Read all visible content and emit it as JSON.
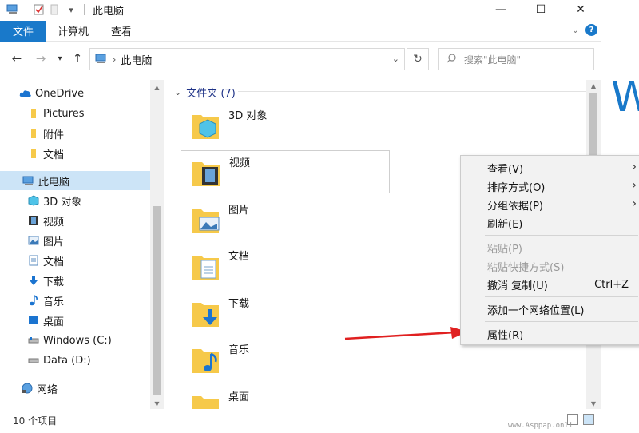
{
  "window": {
    "title": "此电脑",
    "controls": [
      "minimize-icon",
      "maximize-icon",
      "close-icon"
    ]
  },
  "ribbon": {
    "tabs": [
      {
        "label": "文件"
      },
      {
        "label": "计算机"
      },
      {
        "label": "查看"
      }
    ],
    "help": "?"
  },
  "address": {
    "path": "此电脑",
    "search_placeholder": "搜索\"此电脑\""
  },
  "nav": {
    "items": [
      {
        "label": "OneDrive",
        "icon": "cloud-icon"
      },
      {
        "label": "Pictures",
        "icon": "folder-icon"
      },
      {
        "label": "附件",
        "icon": "folder-icon"
      },
      {
        "label": "文档",
        "icon": "folder-icon"
      },
      {
        "label": "此电脑",
        "icon": "pc-icon"
      },
      {
        "label": "3D 对象",
        "icon": "3d-objects-icon"
      },
      {
        "label": "视频",
        "icon": "video-icon"
      },
      {
        "label": "图片",
        "icon": "picture-icon"
      },
      {
        "label": "文档",
        "icon": "document-icon"
      },
      {
        "label": "下载",
        "icon": "download-icon"
      },
      {
        "label": "音乐",
        "icon": "music-icon"
      },
      {
        "label": "桌面",
        "icon": "desktop-icon"
      },
      {
        "label": "Windows (C:)",
        "icon": "drive-icon"
      },
      {
        "label": "Data (D:)",
        "icon": "drive-icon"
      },
      {
        "label": "网络",
        "icon": "network-icon"
      }
    ]
  },
  "content": {
    "group_header": "文件夹 (7)",
    "folders": [
      {
        "label": "3D 对象",
        "icon": "3d-objects-folder-icon"
      },
      {
        "label": "视频",
        "icon": "video-folder-icon"
      },
      {
        "label": "图片",
        "icon": "picture-folder-icon"
      },
      {
        "label": "文档",
        "icon": "document-folder-icon"
      },
      {
        "label": "下载",
        "icon": "download-folder-icon"
      },
      {
        "label": "音乐",
        "icon": "music-folder-icon"
      },
      {
        "label": "桌面",
        "icon": "desktop-folder-icon"
      }
    ]
  },
  "status": {
    "item_count": "10 个项目"
  },
  "context_menu": {
    "items": [
      {
        "label": "查看(V)",
        "submenu": true
      },
      {
        "label": "排序方式(O)",
        "submenu": true
      },
      {
        "label": "分组依据(P)",
        "submenu": true
      },
      {
        "label": "刷新(E)"
      },
      {
        "label": "粘贴(P)",
        "disabled": true
      },
      {
        "label": "粘贴快捷方式(S)",
        "disabled": true
      },
      {
        "label": "撤消 复制(U)",
        "shortcut": "Ctrl+Z"
      },
      {
        "label": "添加一个网络位置(L)"
      },
      {
        "label": "属性(R)"
      }
    ]
  },
  "background_window": {
    "letter": "W"
  },
  "watermark": "www.Asppap.onli",
  "colors": {
    "accent": "#1979ca",
    "selection": "#cce4f7",
    "arrow": "#e02020",
    "folder": "#f6c94a"
  }
}
